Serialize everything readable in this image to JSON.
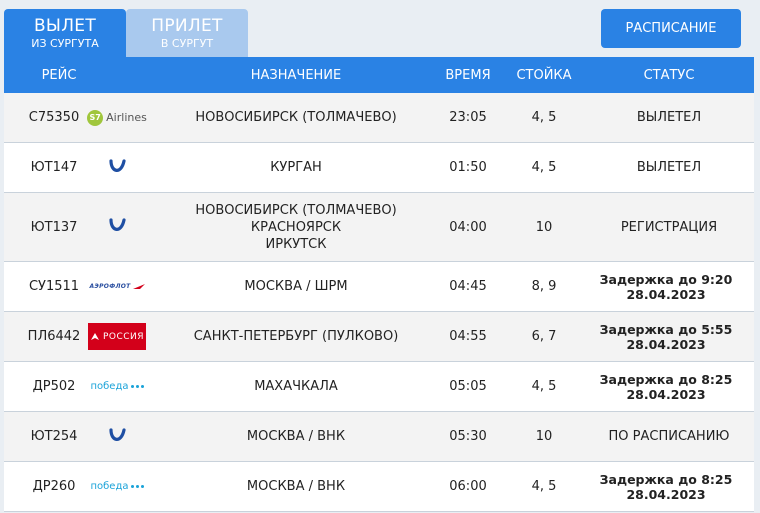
{
  "tabs": [
    {
      "main": "ВЫЛЕТ",
      "sub": "ИЗ СУРГУТА"
    },
    {
      "main": "ПРИЛЕТ",
      "sub": "В СУРГУТ"
    }
  ],
  "schedule_button": "РАСПИСАНИЕ",
  "columns": [
    "РЕЙС",
    "НАЗНАЧЕНИЕ",
    "ВРЕМЯ",
    "СТОЙКА",
    "СТАТУС"
  ],
  "logos": {
    "s7": {
      "mark": "S7",
      "text": "Airlines",
      "color": "#a0c63c"
    },
    "utair": {
      "color": "#1f4fa3"
    },
    "aeroflot": {
      "text": "АЭРОФЛОТ"
    },
    "rossiya": {
      "text": "РОССИЯ",
      "color": "#d3001a"
    },
    "pobeda": {
      "text": "победа",
      "color": "#1aa3d9"
    }
  },
  "flights": [
    {
      "flight": "С75350",
      "airline": "s7",
      "dest": [
        "НОВОСИБИРСК (ТОЛМАЧЕВО)"
      ],
      "time": "23:05",
      "desk": "4, 5",
      "status": "ВЫЛЕТЕЛ",
      "bold": false
    },
    {
      "flight": "ЮТ147",
      "airline": "utair",
      "dest": [
        "КУРГАН"
      ],
      "time": "01:50",
      "desk": "4, 5",
      "status": "ВЫЛЕТЕЛ",
      "bold": false
    },
    {
      "flight": "ЮТ137",
      "airline": "utair",
      "dest": [
        "НОВОСИБИРСК (ТОЛМАЧЕВО)",
        "КРАСНОЯРСК",
        "ИРКУТСК"
      ],
      "time": "04:00",
      "desk": "10",
      "status": "РЕГИСТРАЦИЯ",
      "bold": false
    },
    {
      "flight": "СУ1511",
      "airline": "aeroflot",
      "dest": [
        "МОСКВА / ШРМ"
      ],
      "time": "04:45",
      "desk": "8, 9",
      "status": "Задержка до 9:20 28.04.2023",
      "bold": true
    },
    {
      "flight": "ПЛ6442",
      "airline": "rossiya",
      "dest": [
        "САНКТ-ПЕТЕРБУРГ (ПУЛКОВО)"
      ],
      "time": "04:55",
      "desk": "6, 7",
      "status": "Задержка до 5:55 28.04.2023",
      "bold": true
    },
    {
      "flight": "ДР502",
      "airline": "pobeda",
      "dest": [
        "МАХАЧКАЛА"
      ],
      "time": "05:05",
      "desk": "4, 5",
      "status": "Задержка до 8:25 28.04.2023",
      "bold": true
    },
    {
      "flight": "ЮТ254",
      "airline": "utair",
      "dest": [
        "МОСКВА / ВНК"
      ],
      "time": "05:30",
      "desk": "10",
      "status": "ПО РАСПИСАНИЮ",
      "bold": false
    },
    {
      "flight": "ДР260",
      "airline": "pobeda",
      "dest": [
        "МОСКВА / ВНК"
      ],
      "time": "06:00",
      "desk": "4, 5",
      "status": "Задержка до 8:25 28.04.2023",
      "bold": true
    }
  ]
}
